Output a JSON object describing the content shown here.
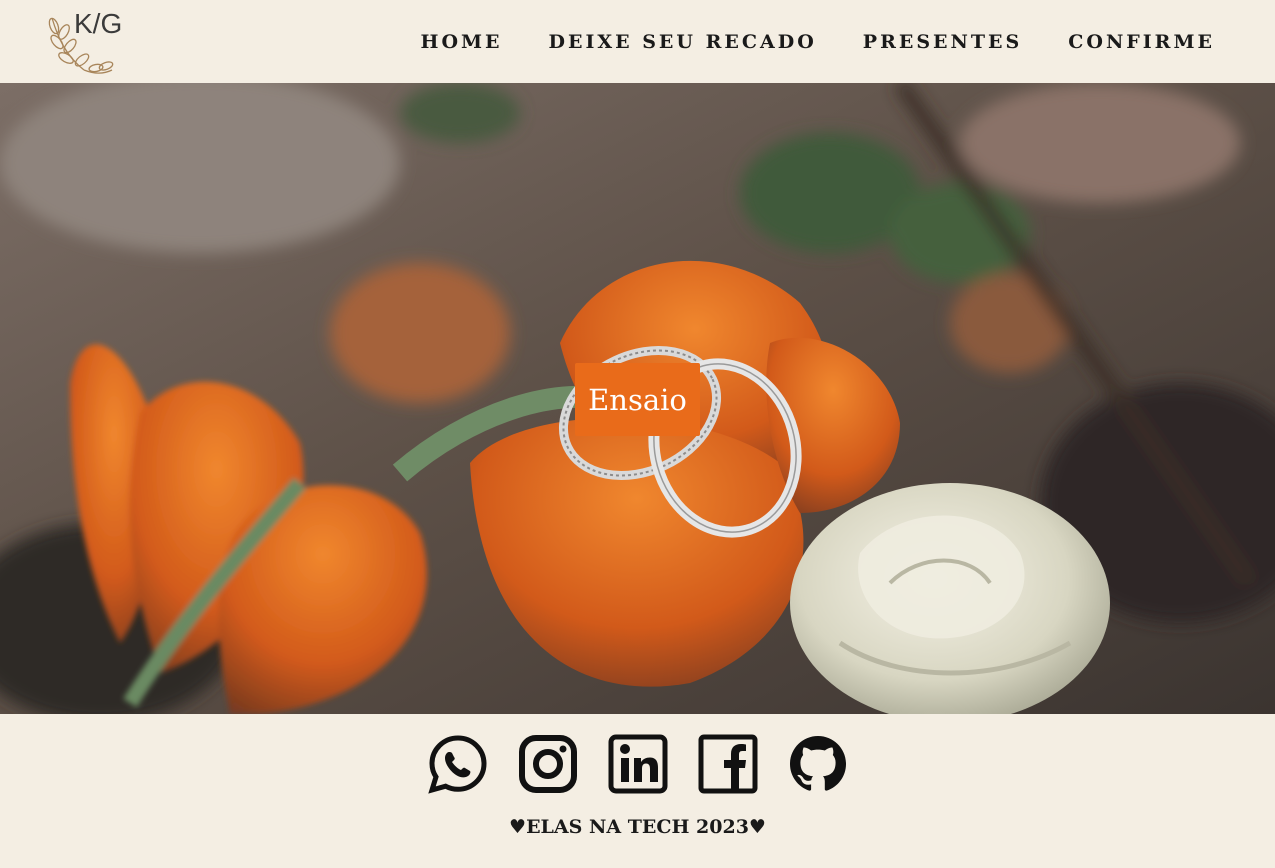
{
  "logo": {
    "text": "K/G"
  },
  "nav": {
    "items": [
      {
        "label": "HOME"
      },
      {
        "label": "DEIXE SEU RECADO"
      },
      {
        "label": "PRESENTES"
      },
      {
        "label": "CONFIRME"
      }
    ]
  },
  "hero": {
    "button_label": "Ensaio",
    "accent_color": "#e96b1a"
  },
  "footer": {
    "social_icons": [
      "whatsapp-icon",
      "instagram-icon",
      "linkedin-icon",
      "facebook-icon",
      "github-icon"
    ],
    "credit": "♥ELAS NA TECH 2023♥"
  },
  "colors": {
    "background": "#f4eee3",
    "text": "#1a1a1a"
  }
}
